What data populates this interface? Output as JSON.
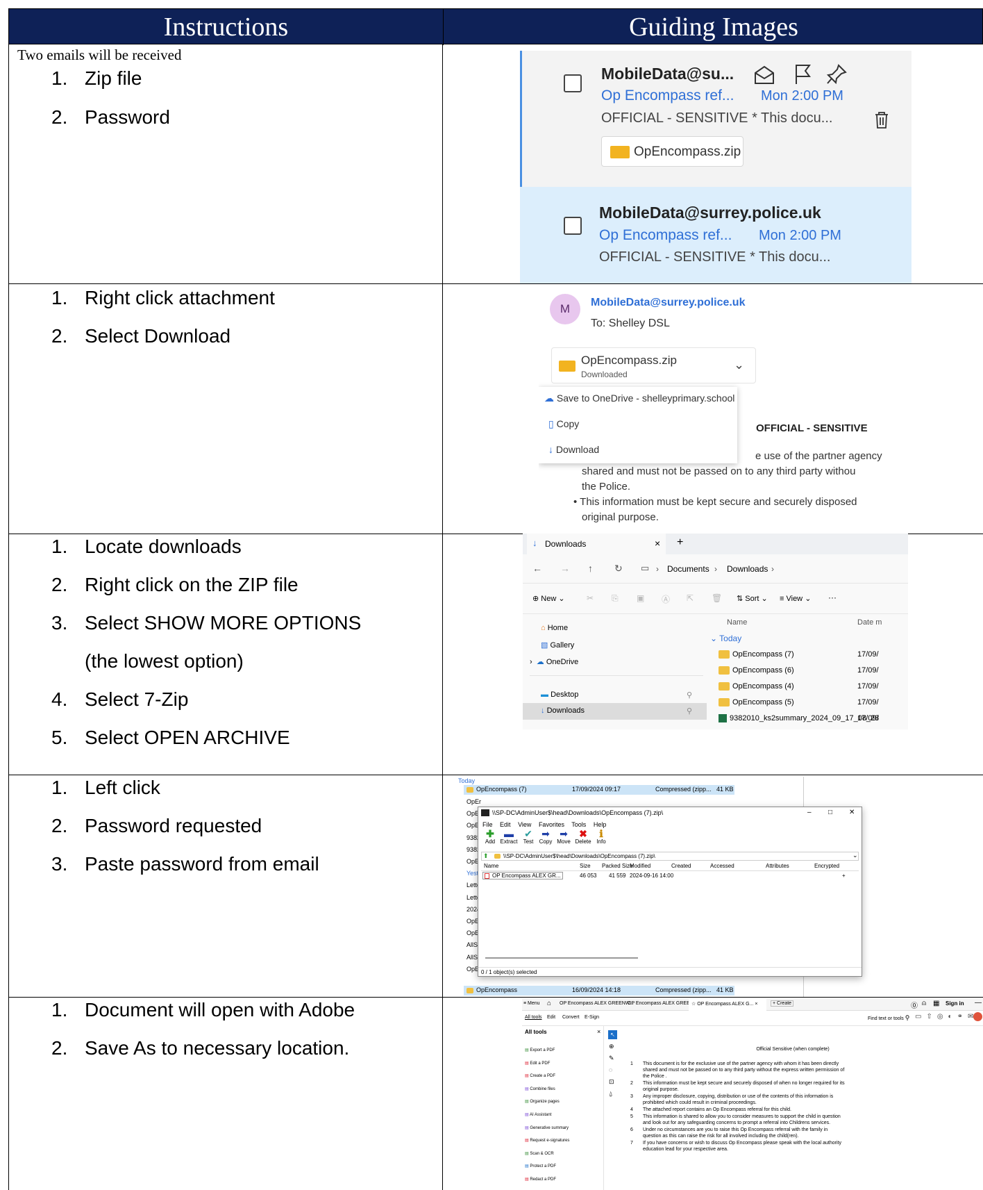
{
  "headers": {
    "instructions": "Instructions",
    "guiding_images": "Guiding Images"
  },
  "rows": [
    {
      "intro": "Two emails will be received",
      "steps": [
        "1.",
        "Zip file",
        "2.",
        "Password"
      ],
      "step_texts": [
        "Zip file",
        "Password"
      ]
    },
    {
      "step_texts": [
        "Right click attachment",
        "Select Download"
      ]
    },
    {
      "step_texts": [
        "Locate downloads",
        "Right click on the ZIP file",
        "Select SHOW MORE OPTIONS",
        "(the lowest option)",
        "Select 7-Zip",
        "Select OPEN ARCHIVE"
      ]
    },
    {
      "step_texts": [
        "Left click",
        "Password requested",
        "Paste password from email"
      ]
    },
    {
      "step_texts": [
        "Document will open with Adobe",
        "Save As to necessary location."
      ]
    }
  ],
  "numbers": [
    "1.",
    "2.",
    "3.",
    "4.",
    "5."
  ],
  "img1": {
    "mail_a": {
      "from": "MobileData@su...",
      "subject": "Op Encompass ref...",
      "time": "Mon 2:00 PM",
      "preview": "OFFICIAL - SENSITIVE * This docu...",
      "attachment": "OpEncompass.zip"
    },
    "mail_b": {
      "from": "MobileData@surrey.police.uk",
      "subject": "Op Encompass ref...",
      "time": "Mon 2:00 PM",
      "preview": "OFFICIAL - SENSITIVE * This docu..."
    }
  },
  "img2": {
    "avatar": "M",
    "from": "MobileData@surrey.police.uk",
    "to": "To: Shelley DSL",
    "attachment": "OpEncompass.zip",
    "attachment_status": "Downloaded",
    "menu": [
      "Save to OneDrive - shelleyprimary.school",
      "Copy",
      "Download"
    ],
    "heading": "OFFICIAL - SENSITIVE",
    "body1": "e use of the partner agency",
    "body2": "shared and must not be passed on to any third party withou",
    "body3": "the Police.",
    "body4": "This information must be kept secure and securely disposed",
    "body5": "original purpose."
  },
  "img3": {
    "tab": "Downloads",
    "crumbs": [
      "Documents",
      "Downloads"
    ],
    "toolbar": {
      "new": "New",
      "sort": "Sort",
      "view": "View",
      "more": "···"
    },
    "nav": [
      "Home",
      "Gallery",
      "OneDrive",
      "Desktop",
      "Downloads"
    ],
    "col_name": "Name",
    "col_date": "Date m",
    "group": "Today",
    "files": [
      "OpEncompass (7)",
      "OpEncompass (6)",
      "OpEncompass (4)",
      "OpEncompass (5)",
      "9382010_ks2summary_2024_09_17_08_28"
    ],
    "file_dates": [
      "17/09/",
      "17/09/",
      "17/09/",
      "17/09/",
      "17/09/"
    ]
  },
  "img4": {
    "group_today": "Today",
    "row1": {
      "name": "OpEncompass (7)",
      "date": "17/09/2024 09:17",
      "type": "Compressed (zipp...",
      "size": "41 KB"
    },
    "bottom_row": {
      "name": "OpEncompass",
      "date": "16/09/2024 14:18",
      "type": "Compressed (zipp...",
      "size": "41 KB"
    },
    "yesterday": "Yester",
    "bg_items": [
      "OpEr",
      "OpEr",
      "OpEr",
      "9382",
      "9382",
      "OpEr",
      "Lette",
      "Lette",
      "2024",
      "OpEr",
      "OpEr",
      "AllSu",
      "AllSu",
      "OpEr"
    ],
    "window_title": "\\\\SP-DC\\AdminUser$\\head\\Downloads\\OpEncompass (7).zip\\",
    "menu": [
      "File",
      "Edit",
      "View",
      "Favorites",
      "Tools",
      "Help"
    ],
    "tools": [
      "Add",
      "Extract",
      "Test",
      "Copy",
      "Move",
      "Delete",
      "Info"
    ],
    "path": "\\\\SP-DC\\AdminUser$\\head\\Downloads\\OpEncompass (7).zip\\",
    "cols": [
      "Name",
      "Size",
      "Packed Size",
      "Modified",
      "Created",
      "Accessed",
      "Attributes",
      "Encrypted"
    ],
    "entry": {
      "name": "OP Encompass ALEX GR...",
      "size": "46 053",
      "packed": "41 559",
      "modified": "2024-09-16 14:00",
      "encrypted": "+"
    },
    "status": "0 / 1 object(s) selected",
    "window_controls": [
      "–",
      "□",
      "✕"
    ]
  },
  "img5": {
    "tabs": [
      "Menu",
      "OP Encompass ALEX GREENW...",
      "OP Encompass ALEX GREENW...",
      "OP Encompass ALEX G...",
      "Create"
    ],
    "signin": "Sign in",
    "menu": [
      "All tools",
      "Edit",
      "Convert",
      "E-Sign"
    ],
    "find": "Find text or tools",
    "panel_title": "All tools",
    "tools": [
      "Export a PDF",
      "Edit a PDF",
      "Create a PDF",
      "Combine files",
      "Organize pages",
      "AI Assistant",
      "Generative summary",
      "Request e-signatures",
      "Scan & OCR",
      "Protect a PDF",
      "Redact a PDF"
    ],
    "doc_title": "Official Sensitive (when complete)",
    "items": [
      {
        "n": "1",
        "lines": [
          "This document is for the exclusive use of the partner agency with whom it has been directly",
          "shared and must not be passed on to any third party without the express written permission of",
          "the Police ."
        ]
      },
      {
        "n": "2",
        "lines": [
          "This information must be kept secure and securely disposed of when no longer required for its",
          "original purpose."
        ]
      },
      {
        "n": "3",
        "lines": [
          "Any improper disclosure, copying, distribution or use of the contents of this information is",
          "prohibited which could result in criminal proceedings."
        ]
      },
      {
        "n": "4",
        "lines": [
          "The attached report contains an Op Encompass referral for this child."
        ]
      },
      {
        "n": "5",
        "lines": [
          "This information is shared to allow you to consider measures to support the child in question",
          "and look out for any safeguarding concerns to prompt a referral into Childrens services."
        ]
      },
      {
        "n": "6",
        "lines": [
          "Under no circumstances are you to raise this Op Encompass referral with the family in",
          "question as this can raise the risk for all involved including the child(ren)."
        ]
      },
      {
        "n": "7",
        "lines": [
          "If you have concerns or wish to discuss Op Encompass please speak with the local authority",
          "education lead for your respective area."
        ]
      }
    ]
  },
  "colors": {
    "header_bg": "#0e2157",
    "accent_blue": "#2f6fd6",
    "selected_mail": "#dceefc"
  }
}
